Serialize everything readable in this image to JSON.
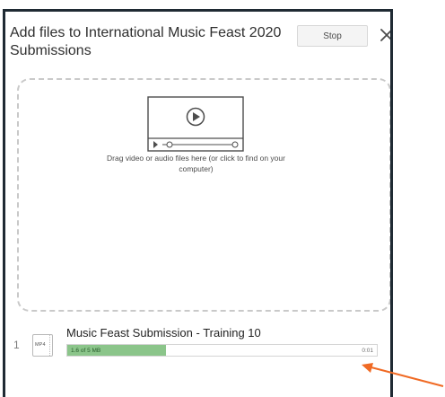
{
  "dialog": {
    "title": "Add files to International Music Feast 2020 Submissions",
    "stop_label": "Stop",
    "close_icon": "close-icon",
    "dropzone": {
      "icon": "video-player-icon",
      "text": "Drag video or audio files here (or click to find on your computer)"
    },
    "upload": {
      "index": "1",
      "file_type": "MP4",
      "file_name": "Music Feast Submission - Training 10",
      "progress_text": "1.6 of 5 MB",
      "progress_fraction": 0.32,
      "time_text": "0:01"
    }
  },
  "annotation": {
    "arrow_color": "#f06a24",
    "progress_color": "#8bc58a"
  }
}
